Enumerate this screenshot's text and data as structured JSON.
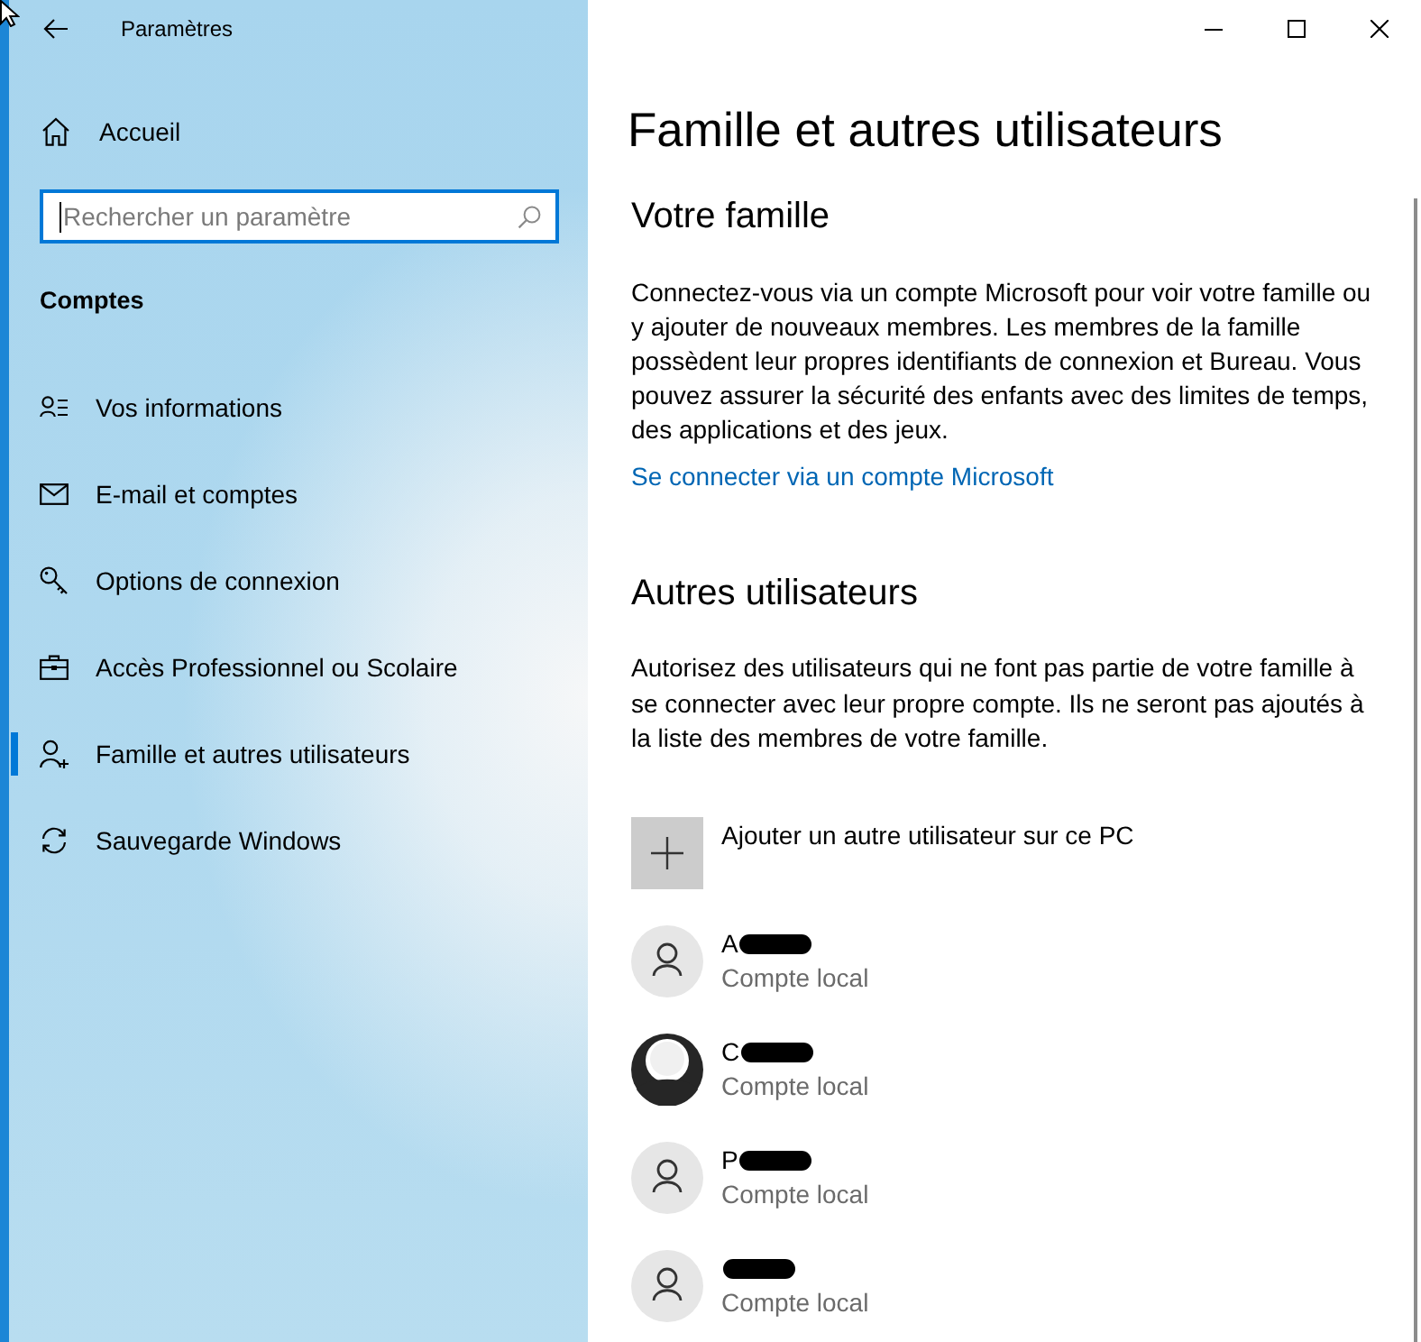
{
  "window": {
    "title": "Paramètres"
  },
  "sidebar": {
    "home": "Accueil",
    "search": {
      "placeholder": "Rechercher un paramètre",
      "focused": true
    },
    "section": "Comptes",
    "items": [
      {
        "label": "Vos informations",
        "kind": "profile",
        "selected": false
      },
      {
        "label": "E-mail et comptes",
        "kind": "email",
        "selected": false
      },
      {
        "label": "Options de connexion",
        "kind": "signin",
        "selected": false
      },
      {
        "label": "Accès Professionnel ou Scolaire",
        "kind": "work",
        "selected": false
      },
      {
        "label": "Famille et autres utilisateurs",
        "kind": "family",
        "selected": true
      },
      {
        "label": "Sauvegarde Windows",
        "kind": "backup",
        "selected": false
      }
    ]
  },
  "page": {
    "title": "Famille et autres utilisateurs",
    "family": {
      "heading": "Votre famille",
      "text": "Connectez-vous via un compte Microsoft pour voir votre famille ou y ajouter de nouveaux membres. Les membres de la famille possèdent leur propres identifiants de connexion et Bureau. Vous pouvez assurer la sécurité des enfants avec des limites de temps, des applications et des jeux.",
      "link": "Se connecter via un compte Microsoft"
    },
    "others": {
      "heading": "Autres utilisateurs",
      "text": "Autorisez des utilisateurs qui ne font pas partie de votre famille à se connecter avec leur propre compte. Ils ne seront pas ajoutés à la liste des membres de votre famille.",
      "add_button": "Ajouter un autre utilisateur sur ce PC",
      "users": [
        {
          "kind": "default",
          "name": "A",
          "redacted": true,
          "account": "Compte local"
        },
        {
          "kind": "dark",
          "name": "C",
          "redacted": true,
          "account": "Compte local"
        },
        {
          "kind": "default",
          "name": "P",
          "redacted": true,
          "account": "Compte local"
        },
        {
          "kind": "default",
          "redacted": true,
          "account": "Compte local"
        }
      ]
    }
  }
}
